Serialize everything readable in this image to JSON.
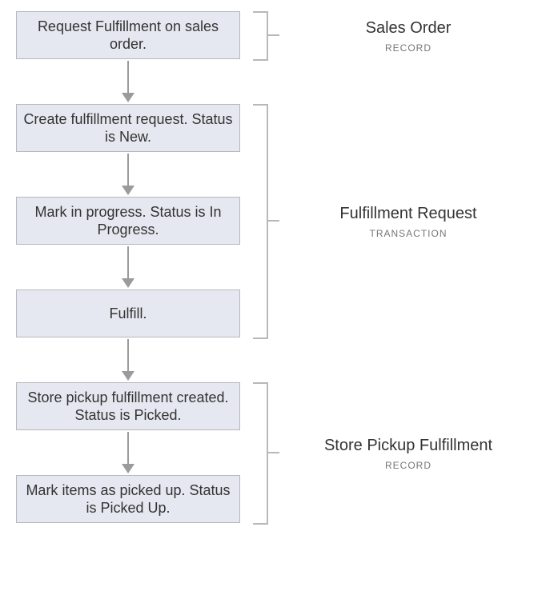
{
  "nodes": {
    "n1": "Request Fulfillment on sales order.",
    "n2": "Create fulfillment request. Status is New.",
    "n3": "Mark in progress. Status is In Progress.",
    "n4": "Fulfill.",
    "n5": "Store pickup fulfillment created. Status is Picked.",
    "n6": "Mark items as picked up. Status is Picked Up."
  },
  "groups": {
    "g1": {
      "title": "Sales Order",
      "sub": "RECORD"
    },
    "g2": {
      "title": "Fulfillment Request",
      "sub": "TRANSACTION"
    },
    "g3": {
      "title": "Store Pickup Fulfillment",
      "sub": "RECORD"
    }
  }
}
